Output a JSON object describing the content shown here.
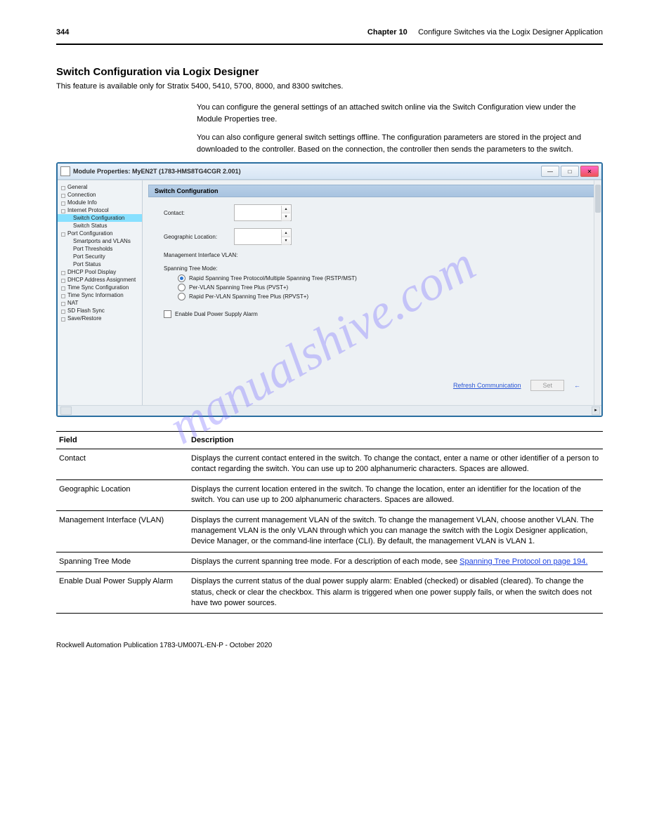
{
  "header": {
    "page_number_top": "344",
    "chapter": "Chapter 10",
    "crumb": "Configure Switches via the Logix Designer Application"
  },
  "section": {
    "title": "Switch Configuration via Logix Designer",
    "note": "This feature is available only for Stratix 5400, 5410, 5700, 8000, and 8300 switches.",
    "para1": "You can configure the general settings of an attached switch online via the Switch Configuration view under the Module Properties tree.",
    "para2": "You can also configure general switch settings offline. The configuration parameters are stored in the project and downloaded to the controller. Based on the connection, the controller then sends the parameters to the switch."
  },
  "window": {
    "title": "Module Properties: MyEN2T (1783-HMS8TG4CGR 2.001)",
    "nav": [
      "General",
      "Connection",
      "Module Info",
      "Internet Protocol",
      "Switch Configuration",
      "Switch Status",
      "Port Configuration",
      "Smartports and VLANs",
      "Port Thresholds",
      "Port Security",
      "Port Status",
      "DHCP Pool Display",
      "DHCP Address Assignment",
      "Time Sync Configuration",
      "Time Sync Information",
      "NAT",
      "SD Flash Sync",
      "Save/Restore"
    ],
    "nav_selected": 4,
    "pane_title": "Switch Configuration",
    "contact_label": "Contact:",
    "geo_label": "Geographic Location:",
    "mgmt_label": "Management Interface VLAN:",
    "spanning_label": "Spanning Tree Mode:",
    "radios": [
      "Rapid Spanning Tree Protocol/Multiple Spanning Tree (RSTP/MST)",
      "Per-VLAN Spanning Tree Plus (PVST+)",
      "Rapid Per-VLAN Spanning Tree Plus (RPVST+)"
    ],
    "radio_checked": 0,
    "checkbox_label": "Enable Dual Power Supply Alarm",
    "refresh": "Refresh Communication",
    "set": "Set",
    "arrow": "←"
  },
  "table": {
    "head_field": "Field",
    "head_desc": "Description",
    "rows": [
      {
        "field": "Contact",
        "desc": "Displays the current contact entered in the switch. To change the contact, enter a name or other identifier of a person to contact regarding the switch. You can use up to 200 alphanumeric characters. Spaces are allowed."
      },
      {
        "field": "Geographic Location",
        "desc": "Displays the current location entered in the switch. To change the location, enter an identifier for the location of the switch. You can use up to 200 alphanumeric characters. Spaces are allowed."
      },
      {
        "field": "Management Interface (VLAN)",
        "desc": "Displays the current management VLAN of the switch. To change the management VLAN, choose another VLAN. The management VLAN is the only VLAN through which you can manage the switch with the Logix Designer application, Device Manager, or the command-line interface (CLI). By default, the management VLAN is VLAN 1."
      },
      {
        "field": "Spanning Tree Mode",
        "desc_pre": "Displays the current spanning tree mode. For a description of each mode, see ",
        "xref": "Spanning Tree Protocol on page 194.",
        "desc_post": ""
      },
      {
        "field": "Enable Dual Power Supply Alarm",
        "desc": "Displays the current status of the dual power supply alarm: Enabled (checked) or disabled (cleared). To change the status, check or clear the checkbox. This alarm is triggered when one power supply fails, or when the switch does not have two power sources."
      }
    ]
  },
  "footer": {
    "pub": "Rockwell Automation Publication 1783-UM007L-EN-P - October 2020"
  },
  "watermark": "manualshive.com"
}
